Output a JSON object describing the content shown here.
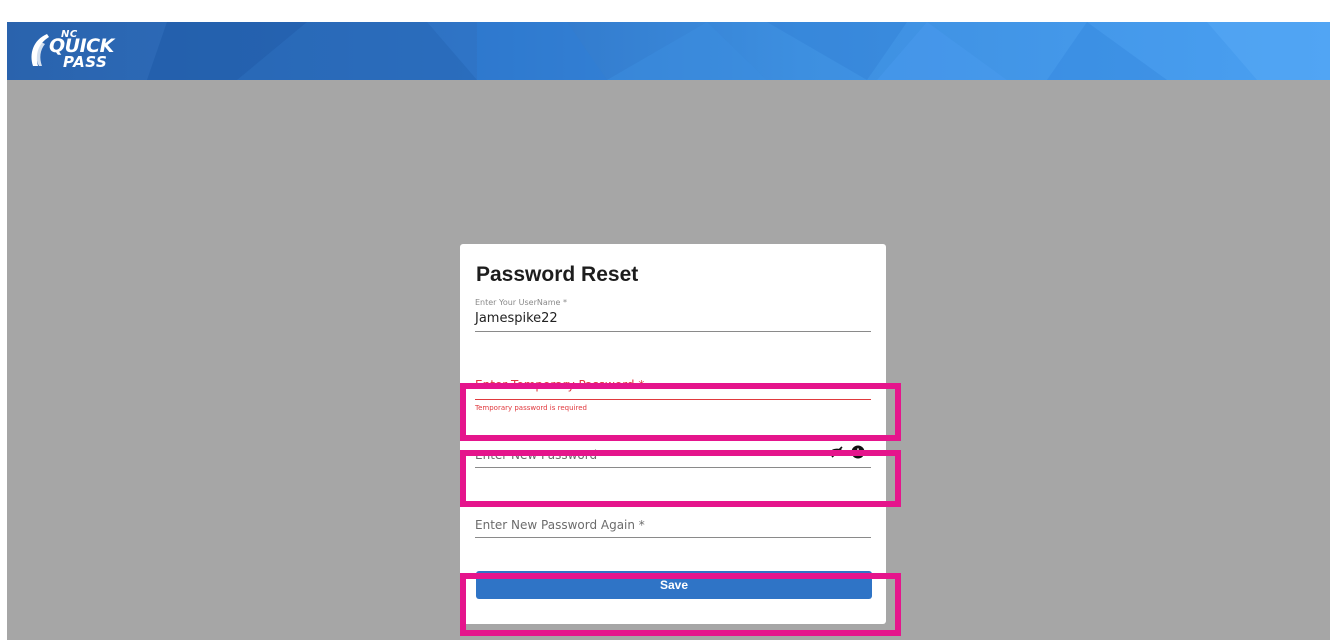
{
  "brand": {
    "logo_nc": "NC",
    "logo_quick": "QUICK",
    "logo_pass": "PASS"
  },
  "form": {
    "title": "Password Reset",
    "username": {
      "label": "Enter Your UserName *",
      "value": "Jamespike22"
    },
    "temp_password": {
      "placeholder": "Enter Temporary Password *",
      "error": "Temporary password is required"
    },
    "new_password": {
      "placeholder": "Enter New Password *",
      "icons": [
        "eye-off-icon",
        "info-icon"
      ]
    },
    "new_password_again": {
      "placeholder": "Enter New Password Again *"
    },
    "save_label": "Save"
  },
  "colors": {
    "header_start": "#2a63ad",
    "header_end": "#4aa0f2",
    "background": "#a6a6a6",
    "error": "#e0393e",
    "button": "#2f74c6",
    "highlight": "#e5158c"
  }
}
